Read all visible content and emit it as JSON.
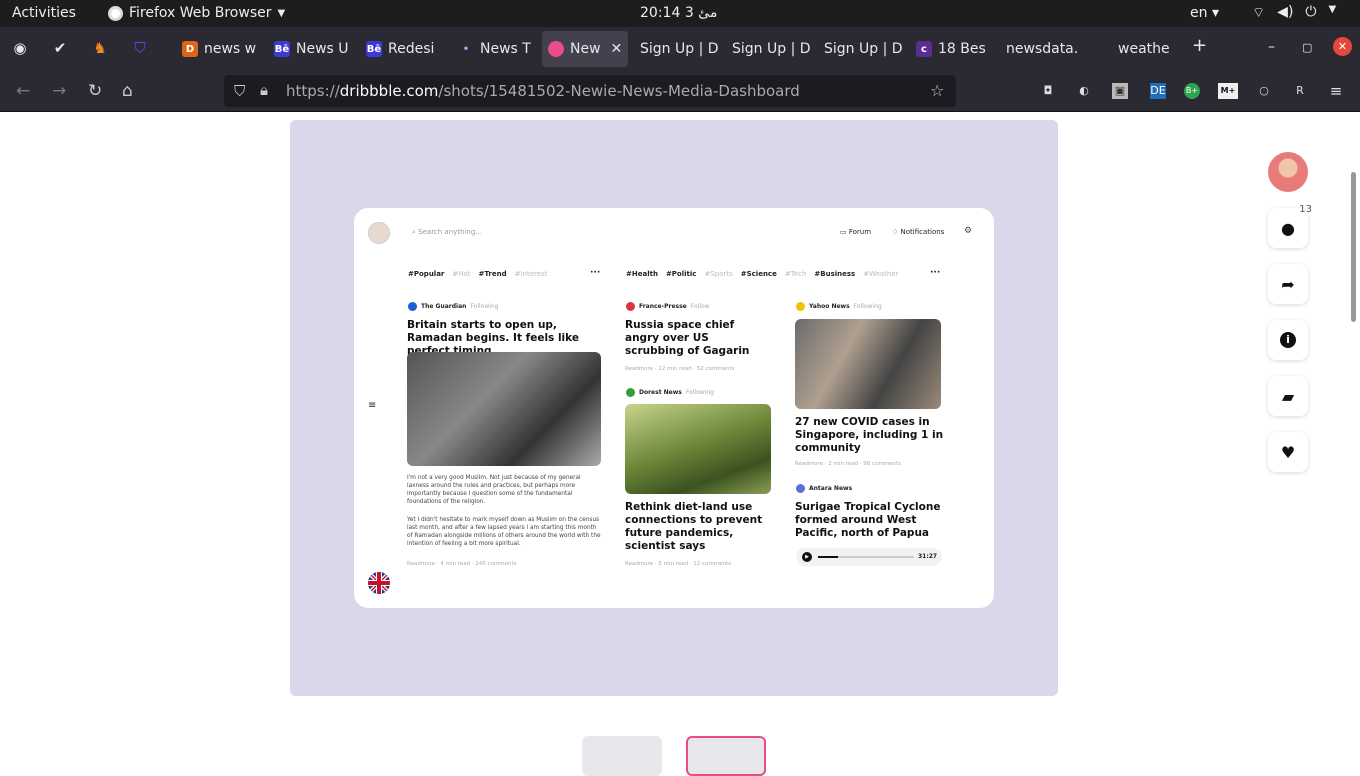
{
  "topbar": {
    "activities": "Activities",
    "app": "Firefox Web Browser",
    "clock": "مئ 3  20:14",
    "lang": "en"
  },
  "tabs": [
    {
      "label": "news w",
      "fav": "#e0631b",
      "icon": "D"
    },
    {
      "label": "News U",
      "fav": "#3b3bd4",
      "icon": "Bē"
    },
    {
      "label": "Redesi",
      "fav": "#3b3bd4",
      "icon": "Bē"
    },
    {
      "label": "News T",
      "fav": "#2b2a33",
      "icon": "•"
    },
    {
      "label": "New",
      "fav": "#ea4c89",
      "icon": "●"
    },
    {
      "label": "Sign Up | D",
      "fav": "",
      "icon": ""
    },
    {
      "label": "Sign Up | D",
      "fav": "",
      "icon": ""
    },
    {
      "label": "Sign Up | D",
      "fav": "",
      "icon": ""
    },
    {
      "label": "18 Bes",
      "fav": "#5a2e91",
      "icon": "c"
    },
    {
      "label": "newsdata.",
      "fav": "",
      "icon": ""
    },
    {
      "label": "weathe",
      "fav": "",
      "icon": ""
    }
  ],
  "url": {
    "prefix": "https://",
    "domain": "dribbble.com",
    "path": "/shots/15481502-Newie-News-Media-Dashboard"
  },
  "ext": {
    "de": "DE",
    "bplus": "B+",
    "mplus": "M+"
  },
  "card": {
    "search": "Search anything...",
    "forum": "Forum",
    "notifications": "Notifications",
    "tags_left": [
      "#Popular",
      "#Hot",
      "#Trend",
      "#Interest"
    ],
    "tags_right": [
      "#Health",
      "#Politic",
      "#Sports",
      "#Science",
      "#Tech",
      "#Business",
      "#Weather"
    ],
    "col1": {
      "source": "The Guardian",
      "follow": "Following",
      "headline": "Britain starts to open up, Ramadan begins. It feels like perfect timing",
      "para1": "I'm not a very good Muslim. Not just because of my general laxness around the rules and practices, but perhaps more importantly because I question some of the fundamental foundations of the religion.",
      "para2": "Yet I didn't hesitate to mark myself down as Muslim on the census last month, and after a few lapsed years I am starting this month of Ramadan alongside millions of others around the world with the intention of feeling a bit more spiritual.",
      "meta": "Readmore  ·  4 min read  ·  245 comments"
    },
    "col2": {
      "source1": "France-Presse",
      "follow1": "Follow",
      "headline1": "Russia space chief angry over US scrubbing of Gagarin",
      "meta1": "Readmore  ·  12 min read  ·  52 comments",
      "source2": "Dorest News",
      "follow2": "Following",
      "headline2": "Rethink diet-land use connections to prevent future pandemics, scientist says",
      "meta2": "Readmore  ·  5 min read  ·  12 comments"
    },
    "col3": {
      "source1": "Yahoo News",
      "follow1": "Following",
      "headline1": "27 new COVID cases in Singapore, including 1 in community",
      "meta1": "Readmore  ·  2 min read  ·  98 comments",
      "source2": "Antara News",
      "follow2": "Follow",
      "headline2": "Surigae Tropical Cyclone formed around West Pacific, north of Papua",
      "duration": "31:27"
    }
  },
  "sidebar": {
    "comments_count": "13"
  }
}
